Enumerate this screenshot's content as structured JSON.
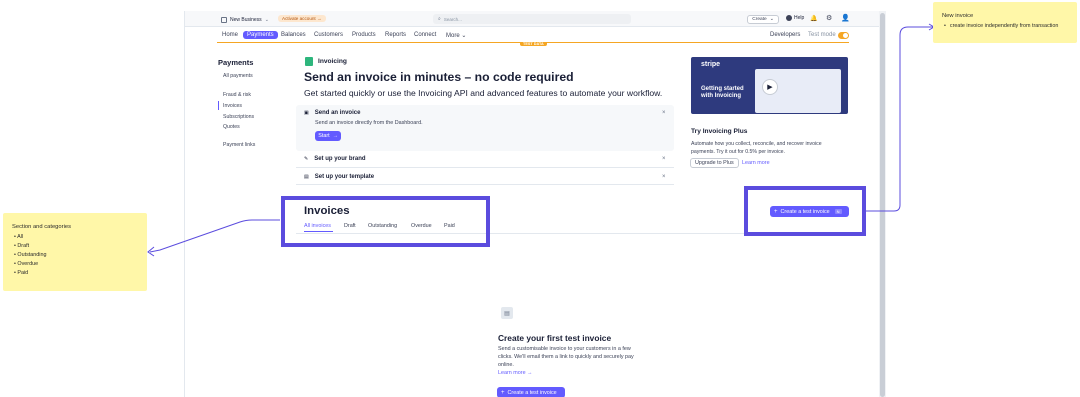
{
  "topbar": {
    "account_name": "New Business",
    "activate_label": "Activate account",
    "search_placeholder": "Search...",
    "create_label": "Create",
    "help_label": "Help"
  },
  "nav": {
    "home": "Home",
    "payments": "Payments",
    "balances": "Balances",
    "customers": "Customers",
    "products": "Products",
    "reports": "Reports",
    "connect": "Connect",
    "more": "More",
    "developers": "Developers",
    "test_mode": "Test mode",
    "test_data_badge": "TEST DATA"
  },
  "sidebar": {
    "title": "Payments",
    "items": [
      "All payments",
      "Fraud & risk",
      "Invoices",
      "Subscriptions",
      "Quotes",
      "Payment links"
    ]
  },
  "hero": {
    "section_label": "Invoicing",
    "headline": "Send an invoice in minutes – no code required",
    "subtext": "Get started quickly or use the Invoicing API and advanced features to automate your workflow."
  },
  "steps": [
    {
      "title": "Send an invoice",
      "desc": "Send an invoice directly from the Dashboard.",
      "button": "Start"
    },
    {
      "title": "Set up your brand"
    },
    {
      "title": "Set up your template"
    }
  ],
  "video": {
    "brand": "stripe",
    "caption_line1": "Getting started",
    "caption_line2": "with Invoicing"
  },
  "plus": {
    "title": "Try Invoicing Plus",
    "desc_line1": "Automate how you collect, reconcile, and recover invoice",
    "desc_line2": "payments. Try it out for 0.5% per invoice.",
    "upgrade": "Upgrade to Plus",
    "learn_more": "Learn more"
  },
  "invoices": {
    "title": "Invoices",
    "tabs": [
      "All invoices",
      "Draft",
      "Outstanding",
      "Overdue",
      "Paid"
    ],
    "create_test": "Create a test invoice",
    "shortcut": "N"
  },
  "empty_state": {
    "title": "Create your first test invoice",
    "desc_line1": "Send a customisable invoice to your customers in a few",
    "desc_line2": "clicks. We'll email them a link to quickly and securely pay",
    "desc_line3": "online.",
    "learn_more": "Learn more",
    "button": "Create a test invoice"
  },
  "annotations": {
    "new_invoice": {
      "title": "New invoice",
      "items": [
        "create invoice independently from transaction"
      ]
    },
    "sections": {
      "title": "Section and categories",
      "items": [
        "All",
        "Draft",
        "Outstanding",
        "Overdue",
        "Paid"
      ]
    }
  },
  "colors": {
    "accent": "#635bff",
    "highlight_frame": "#5b4cde",
    "note_bg": "#fff7a8",
    "test_orange": "#f5a623"
  }
}
